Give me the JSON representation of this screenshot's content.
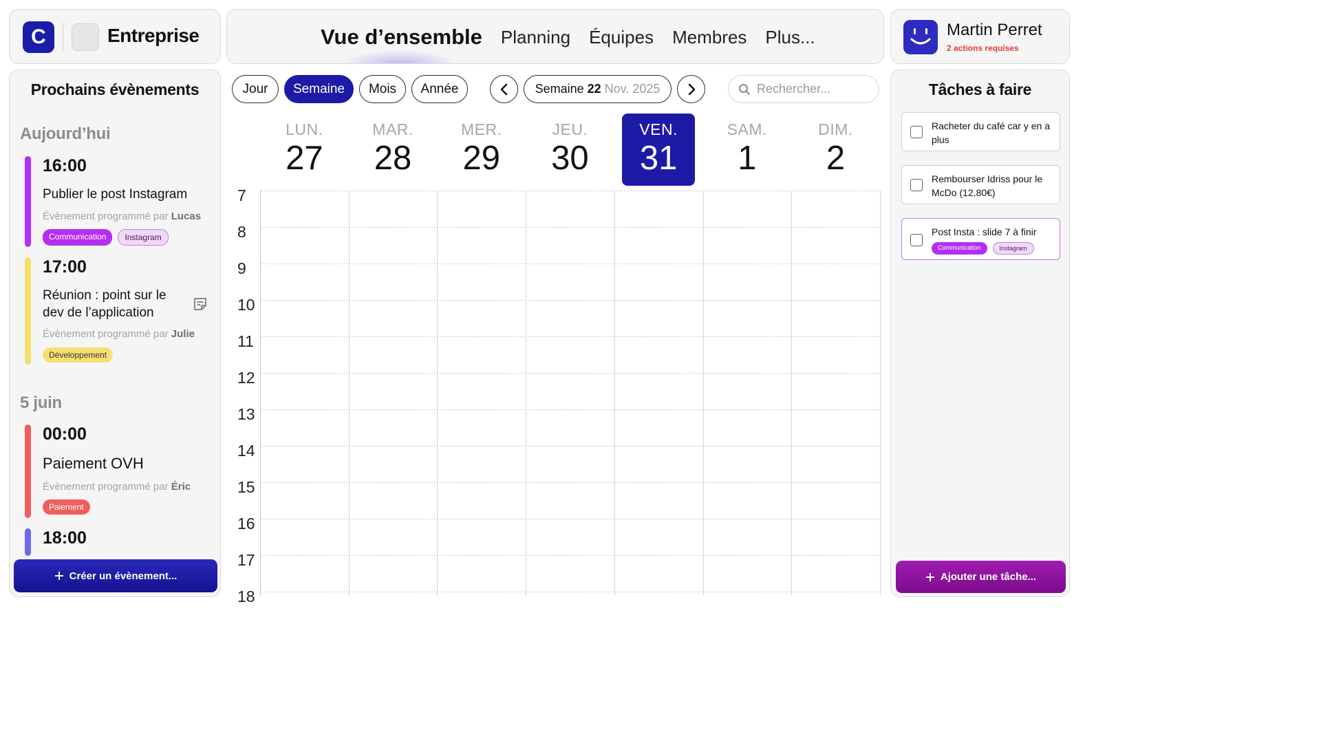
{
  "brand": {
    "logo_letter": "C",
    "name": "Entreprise"
  },
  "nav": {
    "items": [
      {
        "label": "Vue d’ensemble",
        "active": true
      },
      {
        "label": "Planning"
      },
      {
        "label": "Équipes"
      },
      {
        "label": "Membres"
      },
      {
        "label": "Plus..."
      }
    ]
  },
  "user": {
    "name": "Martin Perret",
    "actions": "2 actions requises"
  },
  "events": {
    "title": "Prochains évènements",
    "sections": [
      {
        "label": "Aujourd’hui"
      },
      {
        "label": "5 juin"
      }
    ],
    "items": [
      {
        "time": "16:00",
        "title": "Publier le post Instagram",
        "by_prefix": "Évènement programmé par",
        "by_name": "Lucas",
        "color": "#b42ff0",
        "tags": [
          "Communication",
          "Instagram"
        ]
      },
      {
        "time": "17:00",
        "title": "Réunion : point sur le dev de l’application",
        "by_prefix": "Évènement programmé par",
        "by_name": "Julie",
        "color": "#f5df68",
        "tags": [
          "Développement"
        ],
        "icon": "note-icon"
      },
      {
        "time": "00:00",
        "title": "Paiement OVH",
        "by_prefix": "Évènement programmé par",
        "by_name": "Éric",
        "color": "#ef5e5e",
        "tags": [
          "Paiement"
        ]
      },
      {
        "time": "18:00",
        "color": "#6b6bea"
      }
    ],
    "create_label": "Créer un évènement..."
  },
  "calendar": {
    "views": [
      {
        "label": "Jour"
      },
      {
        "label": "Semaine",
        "selected": true
      },
      {
        "label": "Mois"
      },
      {
        "label": "Année"
      }
    ],
    "week": {
      "prefix": "Semaine",
      "number": "22",
      "month_year": "Nov. 2025"
    },
    "search_placeholder": "Rechercher...",
    "days": [
      {
        "name": "LUN.",
        "num": "27"
      },
      {
        "name": "MAR.",
        "num": "28"
      },
      {
        "name": "MER.",
        "num": "29"
      },
      {
        "name": "JEU.",
        "num": "30"
      },
      {
        "name": "VEN.",
        "num": "31",
        "today": true
      },
      {
        "name": "SAM.",
        "num": "1"
      },
      {
        "name": "DIM.",
        "num": "2"
      }
    ],
    "hours": [
      "7",
      "8",
      "9",
      "10",
      "11",
      "12",
      "13",
      "14",
      "15",
      "16",
      "17",
      "18"
    ]
  },
  "tasks": {
    "title": "Tâches à faire",
    "items": [
      {
        "text": "Racheter du café car y en a plus"
      },
      {
        "text": "Rembourser Idriss pour le McDo (12,80€)"
      },
      {
        "text": "Post Insta : slide 7 à finir",
        "tags": [
          "Communication",
          "Instagram"
        ]
      }
    ],
    "add_label": "Ajouter une tâche..."
  },
  "colors": {
    "primary": "#1d1aa6",
    "tasks_button": "#8a1199",
    "alert": "#e33b3b"
  }
}
